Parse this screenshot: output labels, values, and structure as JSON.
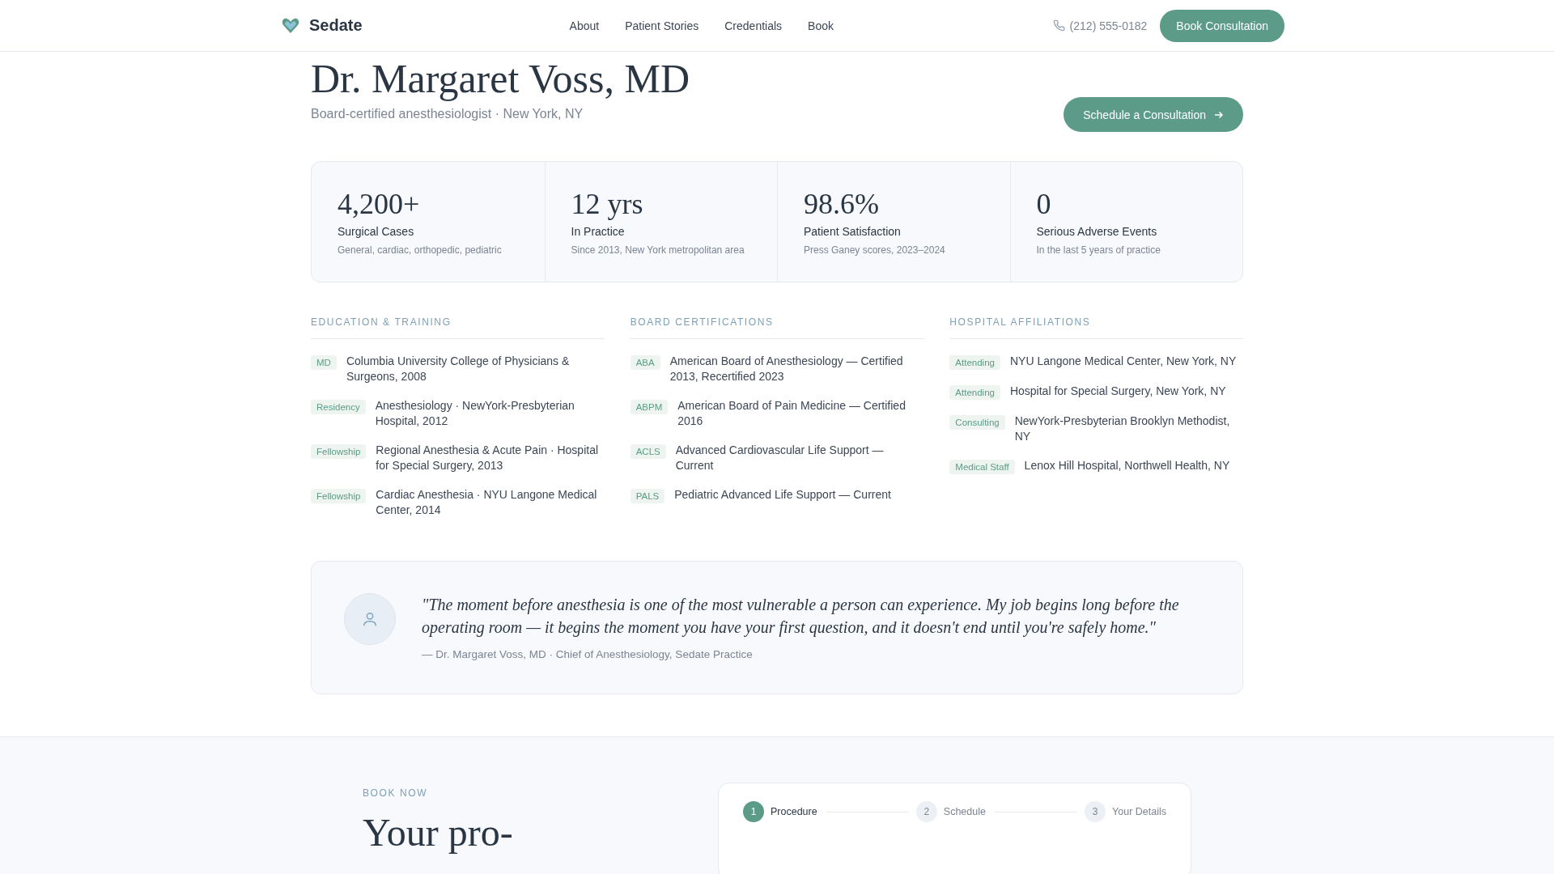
{
  "header": {
    "brand": "Sedate",
    "nav": [
      {
        "label": "About"
      },
      {
        "label": "Patient Stories"
      },
      {
        "label": "Credentials"
      },
      {
        "label": "Book"
      }
    ],
    "phone": "(212) 555-0182",
    "cta": "Book Consultation"
  },
  "hero": {
    "title": "Dr. Margaret Voss, MD",
    "subtitle": "Board-certified anesthesiologist · New York, NY",
    "button": "Schedule a Consultation"
  },
  "stats": [
    {
      "value": "4,200+",
      "label": "Surgical Cases",
      "note": "General, cardiac, orthopedic, pediatric"
    },
    {
      "value": "12 yrs",
      "label": "In Practice",
      "note": "Since 2013, New York metropolitan area"
    },
    {
      "value": "98.6%",
      "label": "Patient Satisfaction",
      "note": "Press Ganey scores, 2023–2024"
    },
    {
      "value": "0",
      "label": "Serious Adverse Events",
      "note": "In the last 5 years of practice"
    }
  ],
  "credentials": [
    {
      "heading": "EDUCATION & TRAINING",
      "items": [
        {
          "tag": "MD",
          "text": "Columbia University College of Physicians & Surgeons, 2008"
        },
        {
          "tag": "Residency",
          "text": "Anesthesiology · NewYork-Presbyterian Hospital, 2012"
        },
        {
          "tag": "Fellowship",
          "text": "Regional Anesthesia & Acute Pain · Hospital for Special Surgery, 2013"
        },
        {
          "tag": "Fellowship",
          "text": "Cardiac Anesthesia · NYU Langone Medical Center, 2014"
        }
      ]
    },
    {
      "heading": "BOARD CERTIFICATIONS",
      "items": [
        {
          "tag": "ABA",
          "text": "American Board of Anesthesiology — Certified 2013, Recertified 2023"
        },
        {
          "tag": "ABPM",
          "text": "American Board of Pain Medicine — Certified 2016"
        },
        {
          "tag": "ACLS",
          "text": "Advanced Cardiovascular Life Support — Current"
        },
        {
          "tag": "PALS",
          "text": "Pediatric Advanced Life Support — Current"
        }
      ]
    },
    {
      "heading": "HOSPITAL AFFILIATIONS",
      "items": [
        {
          "tag": "Attending",
          "text": "NYU Langone Medical Center, New York, NY"
        },
        {
          "tag": "Attending",
          "text": "Hospital for Special Surgery, New York, NY"
        },
        {
          "tag": "Consulting",
          "text": "NewYork-Presbyterian Brooklyn Methodist, NY"
        },
        {
          "tag": "Medical Staff",
          "text": "Lenox Hill Hospital, Northwell Health, NY"
        }
      ]
    }
  ],
  "quote": {
    "text": "\"The moment before anesthesia is one of the most vulnerable a person can experience. My job begins long before the operating room — it begins the moment you have your first question, and it doesn't end until you're safely home.\"",
    "attribution": "— Dr. Margaret Voss, MD · Chief of Anesthesiology, Sedate Practice"
  },
  "booking": {
    "eyebrow": "BOOK NOW",
    "title": "Your pro-",
    "steps": [
      {
        "number": "1",
        "label": "Procedure",
        "selected": true
      },
      {
        "number": "2",
        "label": "Schedule",
        "selected": false
      },
      {
        "number": "3",
        "label": "Your Details",
        "selected": false
      }
    ]
  }
}
